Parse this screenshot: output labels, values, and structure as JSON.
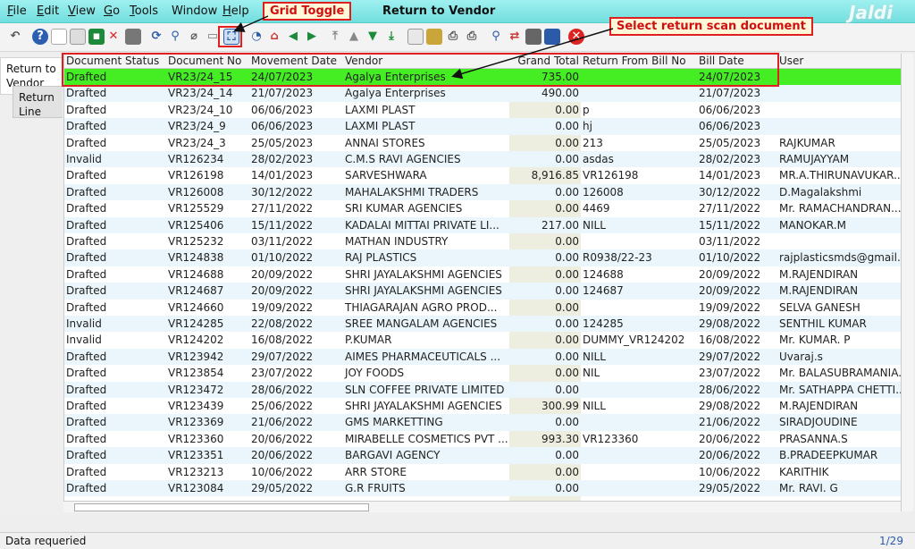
{
  "menu": {
    "file": {
      "u": "F",
      "rest": "ile"
    },
    "edit": {
      "u": "E",
      "rest": "dit"
    },
    "view": {
      "u": "V",
      "rest": "iew"
    },
    "go": {
      "u": "G",
      "rest": "o"
    },
    "tools": {
      "u": "T",
      "rest": "ools"
    },
    "window": "Window",
    "help": {
      "u": "H",
      "rest": "elp"
    }
  },
  "window_title": "Return to Vendor",
  "logo_text": "Jaldi",
  "side_tabs": {
    "return_to_vendor": "Return to Vendor",
    "return_line": "Return Line"
  },
  "annotations": {
    "grid_toggle": "Grid Toggle",
    "select_return_scan": "Select return scan document"
  },
  "grid": {
    "headers": [
      "Document Status",
      "Document No",
      "Movement Date",
      "Vendor",
      "Grand Total",
      "Return From Bill No",
      "Bill Date",
      "User"
    ],
    "rows": [
      [
        "Drafted",
        "VR23/24_15",
        "24/07/2023",
        "Agalya Enterprises",
        "735.00",
        "",
        "24/07/2023",
        ""
      ],
      [
        "Drafted",
        "VR23/24_14",
        "21/07/2023",
        "Agalya Enterprises",
        "490.00",
        "",
        "21/07/2023",
        ""
      ],
      [
        "Drafted",
        "VR23/24_10",
        "06/06/2023",
        "LAXMI PLAST",
        "0.00",
        "p",
        "06/06/2023",
        ""
      ],
      [
        "Drafted",
        "VR23/24_9",
        "06/06/2023",
        "LAXMI PLAST",
        "0.00",
        "hj",
        "06/06/2023",
        ""
      ],
      [
        "Drafted",
        "VR23/24_3",
        "25/05/2023",
        "ANNAI STORES",
        "0.00",
        "213",
        "25/05/2023",
        "RAJKUMAR"
      ],
      [
        "Invalid",
        "VR126234",
        "28/02/2023",
        "C.M.S RAVI AGENCIES",
        "0.00",
        "asdas",
        "28/02/2023",
        "RAMUJAYYAM"
      ],
      [
        "Drafted",
        "VR126198",
        "14/01/2023",
        "SARVESHWARA",
        "8,916.85",
        "VR126198",
        "14/01/2023",
        "MR.A.THIRUNAVUKAR..."
      ],
      [
        "Drafted",
        "VR126008",
        "30/12/2022",
        "MAHALAKSHMI TRADERS",
        "0.00",
        "126008",
        "30/12/2022",
        "D.Magalakshmi"
      ],
      [
        "Drafted",
        "VR125529",
        "27/11/2022",
        "SRI KUMAR AGENCIES",
        "0.00",
        "4469",
        "27/11/2022",
        "Mr. RAMACHANDRAN..."
      ],
      [
        "Drafted",
        "VR125406",
        "15/11/2022",
        "KADALAI MITTAI PRIVATE LI...",
        "217.00",
        "NILL",
        "15/11/2022",
        "MANOKAR.M"
      ],
      [
        "Drafted",
        "VR125232",
        "03/11/2022",
        "MATHAN INDUSTRY",
        "0.00",
        "",
        "03/11/2022",
        ""
      ],
      [
        "Drafted",
        "VR124838",
        "01/10/2022",
        "RAJ PLASTICS",
        "0.00",
        "R0938/22-23",
        "01/10/2022",
        "rajplasticsmds@gmail..."
      ],
      [
        "Drafted",
        "VR124688",
        "20/09/2022",
        "SHRI JAYALAKSHMI AGENCIES",
        "0.00",
        "124688",
        "20/09/2022",
        "M.RAJENDIRAN"
      ],
      [
        "Drafted",
        "VR124687",
        "20/09/2022",
        "SHRI JAYALAKSHMI AGENCIES",
        "0.00",
        "124687",
        "20/09/2022",
        "M.RAJENDIRAN"
      ],
      [
        "Drafted",
        "VR124660",
        "19/09/2022",
        "THIAGARAJAN AGRO PROD...",
        "0.00",
        "",
        "19/09/2022",
        "SELVA GANESH"
      ],
      [
        "Invalid",
        "VR124285",
        "22/08/2022",
        "SREE MANGALAM AGENCIES",
        "0.00",
        "124285",
        "29/08/2022",
        "SENTHIL KUMAR"
      ],
      [
        "Invalid",
        "VR124202",
        "16/08/2022",
        "P.KUMAR",
        "0.00",
        "DUMMY_VR124202",
        "16/08/2022",
        "Mr. KUMAR. P"
      ],
      [
        "Drafted",
        "VR123942",
        "29/07/2022",
        "AIMES PHARMACEUTICALS ...",
        "0.00",
        "NILL",
        "29/07/2022",
        "Uvaraj.s"
      ],
      [
        "Drafted",
        "VR123854",
        "23/07/2022",
        "JOY FOODS",
        "0.00",
        "NIL",
        "23/07/2022",
        "Mr. BALASUBRAMANIA..."
      ],
      [
        "Drafted",
        "VR123472",
        "28/06/2022",
        "SLN COFFEE PRIVATE LIMITED",
        "0.00",
        "",
        "28/06/2022",
        "Mr. SATHAPPA CHETTI..."
      ],
      [
        "Drafted",
        "VR123439",
        "25/06/2022",
        "SHRI JAYALAKSHMI AGENCIES",
        "300.99",
        "NILL",
        "29/08/2022",
        "M.RAJENDIRAN"
      ],
      [
        "Drafted",
        "VR123369",
        "21/06/2022",
        "GMS MARKETTING",
        "0.00",
        "",
        "21/06/2022",
        "SIRADJOUDINE"
      ],
      [
        "Drafted",
        "VR123360",
        "20/06/2022",
        "MIRABELLE COSMETICS PVT ...",
        "993.30",
        "VR123360",
        "20/06/2022",
        "PRASANNA.S"
      ],
      [
        "Drafted",
        "VR123351",
        "20/06/2022",
        "BARGAVI AGENCY",
        "0.00",
        "",
        "20/06/2022",
        "B.PRADEEPKUMAR"
      ],
      [
        "Drafted",
        "VR123213",
        "10/06/2022",
        "ARR STORE",
        "0.00",
        "",
        "10/06/2022",
        "KARITHIK"
      ],
      [
        "Drafted",
        "VR123084",
        "29/05/2022",
        "G.R FRUITS",
        "0.00",
        "",
        "29/05/2022",
        "Mr. RAVI. G"
      ]
    ]
  },
  "status": {
    "message": "Data requeried",
    "page_counter": "1/29"
  },
  "colors": {
    "selected_row": "#44ee22",
    "annotation_red": "#e02020",
    "menubar": "#8fe8e8"
  }
}
